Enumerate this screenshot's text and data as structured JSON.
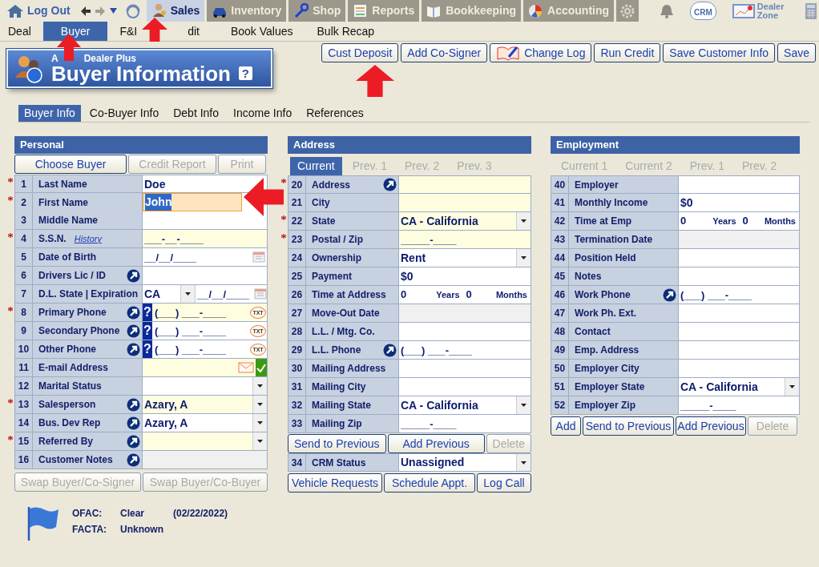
{
  "top_nav": {
    "logout": "Log Out",
    "history_buttons": [
      {
        "disabled": false
      },
      {
        "disabled": true
      }
    ],
    "modules": [
      {
        "label": "Sales",
        "selected": true
      },
      {
        "label": "Inventory",
        "selected": false
      },
      {
        "label": "Shop",
        "selected": false
      },
      {
        "label": "Reports",
        "selected": false
      },
      {
        "label": "Bookkeeping",
        "selected": false
      },
      {
        "label": "Accounting",
        "selected": false
      }
    ],
    "crm": "CRM",
    "dealer_zone": "Dealer Zone"
  },
  "sub_nav": [
    {
      "label": "Deal",
      "selected": false
    },
    {
      "label": "Buyer",
      "selected": true
    },
    {
      "label": "F&I",
      "selected": false
    },
    {
      "label": "dit",
      "selected": false
    },
    {
      "label": "Book Values",
      "selected": false
    },
    {
      "label": "Bulk Recap",
      "selected": false
    }
  ],
  "actions": [
    {
      "label": "Cust Deposit",
      "kind": "plain"
    },
    {
      "label": "Add Co-Signer",
      "kind": "plain"
    },
    {
      "label": "Change Log",
      "kind": "icon"
    },
    {
      "label": "Run Credit",
      "kind": "plain"
    },
    {
      "label": "Save Customer Info",
      "kind": "plain"
    },
    {
      "label": "Save",
      "kind": "plain"
    }
  ],
  "banner": {
    "subtitle_parts": [
      "A",
      "Dealer Plus"
    ],
    "title": "Buyer Information",
    "help": "?"
  },
  "section_tabs": [
    {
      "label": "Buyer Info",
      "selected": true
    },
    {
      "label": "Co-Buyer Info",
      "selected": false
    },
    {
      "label": "Debt Info",
      "selected": false
    },
    {
      "label": "Income Info",
      "selected": false
    },
    {
      "label": "References",
      "selected": false
    }
  ],
  "personal": {
    "title": "Personal",
    "buttons": [
      {
        "label": "Choose Buyer",
        "disabled": false
      },
      {
        "label": "Credit Report",
        "disabled": true
      },
      {
        "label": "Print",
        "disabled": true
      }
    ],
    "rows": [
      {
        "num": "1",
        "label": "Last Name",
        "required": true,
        "link": false,
        "kind": "text",
        "value": "Doe",
        "highlighted": false
      },
      {
        "num": "2",
        "label": "First Name",
        "required": true,
        "link": false,
        "kind": "text",
        "value": "John",
        "highlighted": false,
        "focused": true
      },
      {
        "num": "3",
        "label": "Middle Name",
        "required": false,
        "link": false,
        "kind": "text",
        "highlighted": false
      },
      {
        "num": "4",
        "label": "S.S.N.",
        "history": "History",
        "required": true,
        "link": false,
        "kind": "masked",
        "placeholder": "___-__-____",
        "highlighted": true
      },
      {
        "num": "5",
        "label": "Date of Birth",
        "required": false,
        "link": false,
        "kind": "date",
        "placeholder": "__/__/____",
        "highlighted": false
      },
      {
        "num": "6",
        "label": "Drivers Lic / ID",
        "required": false,
        "link": true,
        "kind": "text",
        "highlighted": false
      },
      {
        "num": "7",
        "label": "D.L. State | Expiration",
        "required": false,
        "link": false,
        "kind": "dlstate",
        "value": "CA",
        "placeholder": "__/__/____",
        "highlighted": false
      },
      {
        "num": "8",
        "label": "Primary Phone",
        "required": true,
        "link": true,
        "kind": "phone",
        "verify": "?",
        "placeholder": "(___) ___-____",
        "sms": "TXT",
        "highlighted": true
      },
      {
        "num": "9",
        "label": "Secondary Phone",
        "required": false,
        "link": true,
        "kind": "phone",
        "verify": "?",
        "placeholder": "(___) ___-____",
        "sms": "TXT",
        "highlighted": false
      },
      {
        "num": "10",
        "label": "Other Phone",
        "required": false,
        "link": true,
        "kind": "phone",
        "verify": "?",
        "placeholder": "(___) ___-____",
        "sms": "TXT",
        "highlighted": false
      },
      {
        "num": "11",
        "label": "E-mail Address",
        "required": false,
        "link": false,
        "kind": "email",
        "highlighted": true
      },
      {
        "num": "12",
        "label": "Marital Status",
        "required": false,
        "link": false,
        "kind": "select",
        "highlighted": false
      },
      {
        "num": "13",
        "label": "Salesperson",
        "required": true,
        "link": true,
        "kind": "select",
        "value": "Azary, A",
        "highlighted": true
      },
      {
        "num": "14",
        "label": "Bus. Dev Rep",
        "required": false,
        "link": true,
        "kind": "select",
        "value": "Azary, A",
        "highlighted": false
      },
      {
        "num": "15",
        "label": "Referred By",
        "required": true,
        "link": true,
        "kind": "select",
        "highlighted": true
      },
      {
        "num": "16",
        "label": "Customer Notes",
        "required": false,
        "link": true,
        "kind": "text",
        "highlighted": false,
        "disabled": true
      }
    ],
    "bottom_buttons": [
      {
        "label": "Swap Buyer/Co-Signer",
        "disabled": true
      },
      {
        "label": "Swap Buyer/Co-Buyer",
        "disabled": true
      }
    ]
  },
  "address": {
    "title": "Address",
    "tabs": [
      {
        "label": "Current",
        "selected": true
      },
      {
        "label": "Prev. 1",
        "selected": false
      },
      {
        "label": "Prev. 2",
        "selected": false
      },
      {
        "label": "Prev. 3",
        "selected": false
      }
    ],
    "rows": [
      {
        "num": "20",
        "label": "Address",
        "required": true,
        "link": true,
        "kind": "text",
        "highlighted": true
      },
      {
        "num": "21",
        "label": "City",
        "required": false,
        "link": false,
        "kind": "text",
        "highlighted": true
      },
      {
        "num": "22",
        "label": "State",
        "required": true,
        "link": false,
        "kind": "select",
        "value": "CA - California",
        "highlighted": true
      },
      {
        "num": "23",
        "label": "Postal / Zip",
        "required": true,
        "link": false,
        "kind": "masked",
        "placeholder": "_____-____",
        "highlighted": true
      },
      {
        "num": "24",
        "label": "Ownership",
        "required": false,
        "link": false,
        "kind": "select",
        "value": "Rent",
        "highlighted": false
      },
      {
        "num": "25",
        "label": "Payment",
        "required": false,
        "link": false,
        "kind": "text",
        "value": "$0",
        "highlighted": false
      },
      {
        "num": "26",
        "label": "Time at Address",
        "required": false,
        "link": false,
        "kind": "duration",
        "years": "0",
        "years_label": "Years",
        "months": "0",
        "months_label": "Months",
        "highlighted": false
      },
      {
        "num": "27",
        "label": "Move-Out Date",
        "required": false,
        "link": false,
        "kind": "text",
        "highlighted": false,
        "disabled": true
      },
      {
        "num": "28",
        "label": "L.L. / Mtg. Co.",
        "required": false,
        "link": false,
        "kind": "text",
        "highlighted": false
      },
      {
        "num": "29",
        "label": "L.L. Phone",
        "required": false,
        "link": true,
        "kind": "masked",
        "placeholder": "(___) ___-____",
        "highlighted": false
      },
      {
        "num": "30",
        "label": "Mailing Address",
        "required": false,
        "link": false,
        "kind": "text",
        "highlighted": false
      },
      {
        "num": "31",
        "label": "Mailing City",
        "required": false,
        "link": false,
        "kind": "text",
        "highlighted": false
      },
      {
        "num": "32",
        "label": "Mailing State",
        "required": false,
        "link": false,
        "kind": "select",
        "value": "CA - California",
        "highlighted": false
      },
      {
        "num": "33",
        "label": "Mailing Zip",
        "required": false,
        "link": false,
        "kind": "masked",
        "placeholder": "_____-____",
        "highlighted": false
      }
    ],
    "buttons": [
      {
        "label": "Send to Previous",
        "disabled": false
      },
      {
        "label": "Add Previous",
        "disabled": false
      },
      {
        "label": "Delete",
        "disabled": true
      }
    ],
    "crm_row": {
      "num": "34",
      "label": "CRM Status",
      "required": false,
      "link": false,
      "kind": "select",
      "value": "Unassigned",
      "highlighted": false
    },
    "bottom_buttons": [
      {
        "label": "Vehicle Requests",
        "disabled": false
      },
      {
        "label": "Schedule Appt.",
        "disabled": false
      },
      {
        "label": "Log Call",
        "disabled": false
      }
    ]
  },
  "employment": {
    "title": "Employment",
    "tabs": [
      {
        "label": "Current 1",
        "selected": false
      },
      {
        "label": "Current 2",
        "selected": false
      },
      {
        "label": "Prev. 1",
        "selected": false
      },
      {
        "label": "Prev. 2",
        "selected": false
      }
    ],
    "rows": [
      {
        "num": "40",
        "label": "Employer",
        "required": false,
        "link": false,
        "kind": "text",
        "highlighted": false
      },
      {
        "num": "41",
        "label": "Monthly Income",
        "required": false,
        "link": false,
        "kind": "text",
        "value": "$0",
        "highlighted": false
      },
      {
        "num": "42",
        "label": "Time at Emp",
        "required": false,
        "link": false,
        "kind": "duration",
        "years": "0",
        "years_label": "Years",
        "months": "0",
        "months_label": "Months",
        "highlighted": false
      },
      {
        "num": "43",
        "label": "Termination Date",
        "required": false,
        "link": false,
        "kind": "text",
        "highlighted": false,
        "disabled": true
      },
      {
        "num": "44",
        "label": "Position Held",
        "required": false,
        "link": false,
        "kind": "text",
        "highlighted": false
      },
      {
        "num": "45",
        "label": "Notes",
        "required": false,
        "link": false,
        "kind": "text",
        "highlighted": false
      },
      {
        "num": "46",
        "label": "Work Phone",
        "required": false,
        "link": true,
        "kind": "masked",
        "placeholder": "(___) ___-____",
        "highlighted": false
      },
      {
        "num": "47",
        "label": "Work Ph. Ext.",
        "required": false,
        "link": false,
        "kind": "text",
        "highlighted": false
      },
      {
        "num": "48",
        "label": "Contact",
        "required": false,
        "link": false,
        "kind": "text",
        "highlighted": false
      },
      {
        "num": "49",
        "label": "Emp. Address",
        "required": false,
        "link": false,
        "kind": "text",
        "highlighted": false
      },
      {
        "num": "50",
        "label": "Employer City",
        "required": false,
        "link": false,
        "kind": "text",
        "highlighted": false
      },
      {
        "num": "51",
        "label": "Employer State",
        "required": false,
        "link": false,
        "kind": "select",
        "value": "CA - California",
        "highlighted": false
      },
      {
        "num": "52",
        "label": "Employer Zip",
        "required": false,
        "link": false,
        "kind": "masked",
        "placeholder": "_____-____",
        "highlighted": false
      }
    ],
    "buttons": [
      {
        "label": "Add",
        "disabled": false
      },
      {
        "label": "Send to Previous",
        "disabled": false
      },
      {
        "label": "Add Previous",
        "disabled": false
      },
      {
        "label": "Delete",
        "disabled": true
      }
    ]
  },
  "screening": [
    {
      "label": "OFAC:",
      "status": "Clear",
      "date": "(02/22/2022)"
    },
    {
      "label": "FACTA:",
      "status": "Unknown"
    }
  ],
  "annotations": [
    {
      "kind": "arrow_up"
    },
    {
      "kind": "arrow_up"
    },
    {
      "kind": "arrow_up"
    },
    {
      "kind": "arrow_left"
    }
  ]
}
